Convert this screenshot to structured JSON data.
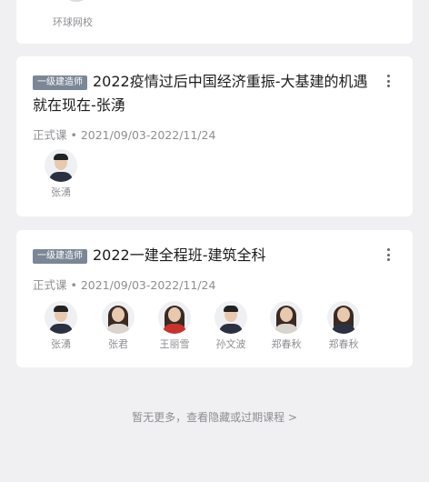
{
  "top_card": {
    "caption": "环球网校"
  },
  "courses": [
    {
      "badge": "一级建造师",
      "title": "2022疫情过后中国经济重振-大基建的机遇就在现在-张湧",
      "meta": "正式课 • 2021/09/03-2022/11/24",
      "teachers": [
        {
          "name": "张湧"
        }
      ]
    },
    {
      "badge": "一级建造师",
      "title": "2022一建全程班-建筑全科",
      "meta": "正式课 • 2021/09/03-2022/11/24",
      "teachers": [
        {
          "name": "张湧"
        },
        {
          "name": "张君"
        },
        {
          "name": "王丽雪"
        },
        {
          "name": "孙文波"
        },
        {
          "name": "郑春秋"
        },
        {
          "name": "郑春秋"
        }
      ]
    }
  ],
  "footer": {
    "link_text": "暂无更多，查看隐藏或过期课程 >"
  }
}
